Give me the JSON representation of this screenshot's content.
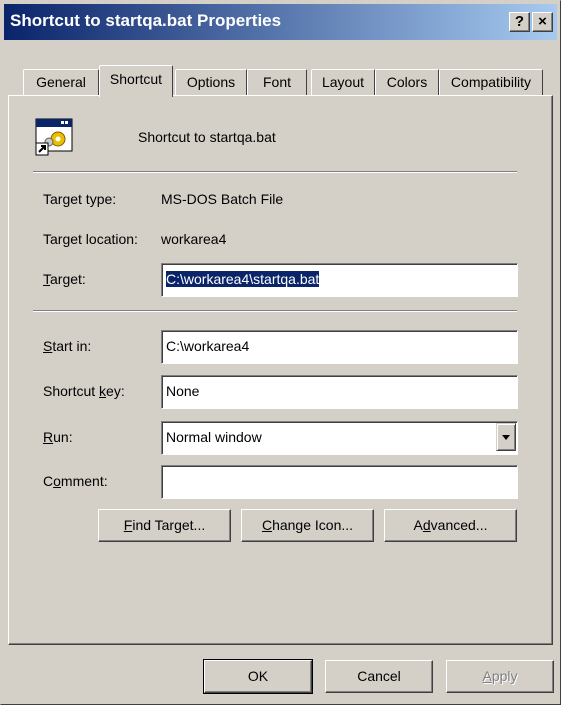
{
  "window": {
    "title": "Shortcut to startqa.bat Properties",
    "help_label": "?",
    "close_label": "×"
  },
  "tabs": [
    {
      "label": "General"
    },
    {
      "label": "Shortcut"
    },
    {
      "label": "Options"
    },
    {
      "label": "Font"
    },
    {
      "label": "Layout"
    },
    {
      "label": "Colors"
    },
    {
      "label": "Compatibility"
    }
  ],
  "active_tab": "Shortcut",
  "shortcut": {
    "name": "Shortcut to startqa.bat",
    "target_type_label": "Target type:",
    "target_type_value": "MS-DOS Batch File",
    "target_location_label": "Target location:",
    "target_location_value": "workarea4",
    "target_label_rest": "arget:",
    "target_label_key": "T",
    "target_value": "C:\\workarea4\\startqa.bat",
    "start_in_label_key": "S",
    "start_in_label_rest": "tart in:",
    "start_in_value": "C:\\workarea4",
    "shortcut_key_label_pre": "Shortcut ",
    "shortcut_key_label_key": "k",
    "shortcut_key_label_rest": "ey:",
    "shortcut_key_value": "None",
    "run_label_key": "R",
    "run_label_rest": "un:",
    "run_value": "Normal window",
    "comment_label_pre": "C",
    "comment_label_key": "o",
    "comment_label_rest": "mment:",
    "comment_value": ""
  },
  "buttons": {
    "find_target_key": "F",
    "find_target_rest": "ind Target...",
    "change_icon_key": "C",
    "change_icon_rest": "hange Icon...",
    "advanced_pre": "A",
    "advanced_key": "d",
    "advanced_rest": "vanced...",
    "ok": "OK",
    "cancel": "Cancel",
    "apply_key": "A",
    "apply_rest": "pply"
  },
  "colors": {
    "face": "#d4d0c8",
    "title_start": "#0a246a",
    "title_end": "#a6caf0",
    "selection": "#0a246a"
  },
  "icons": [
    "shortcut-app-icon",
    "dropdown-arrow-icon"
  ]
}
